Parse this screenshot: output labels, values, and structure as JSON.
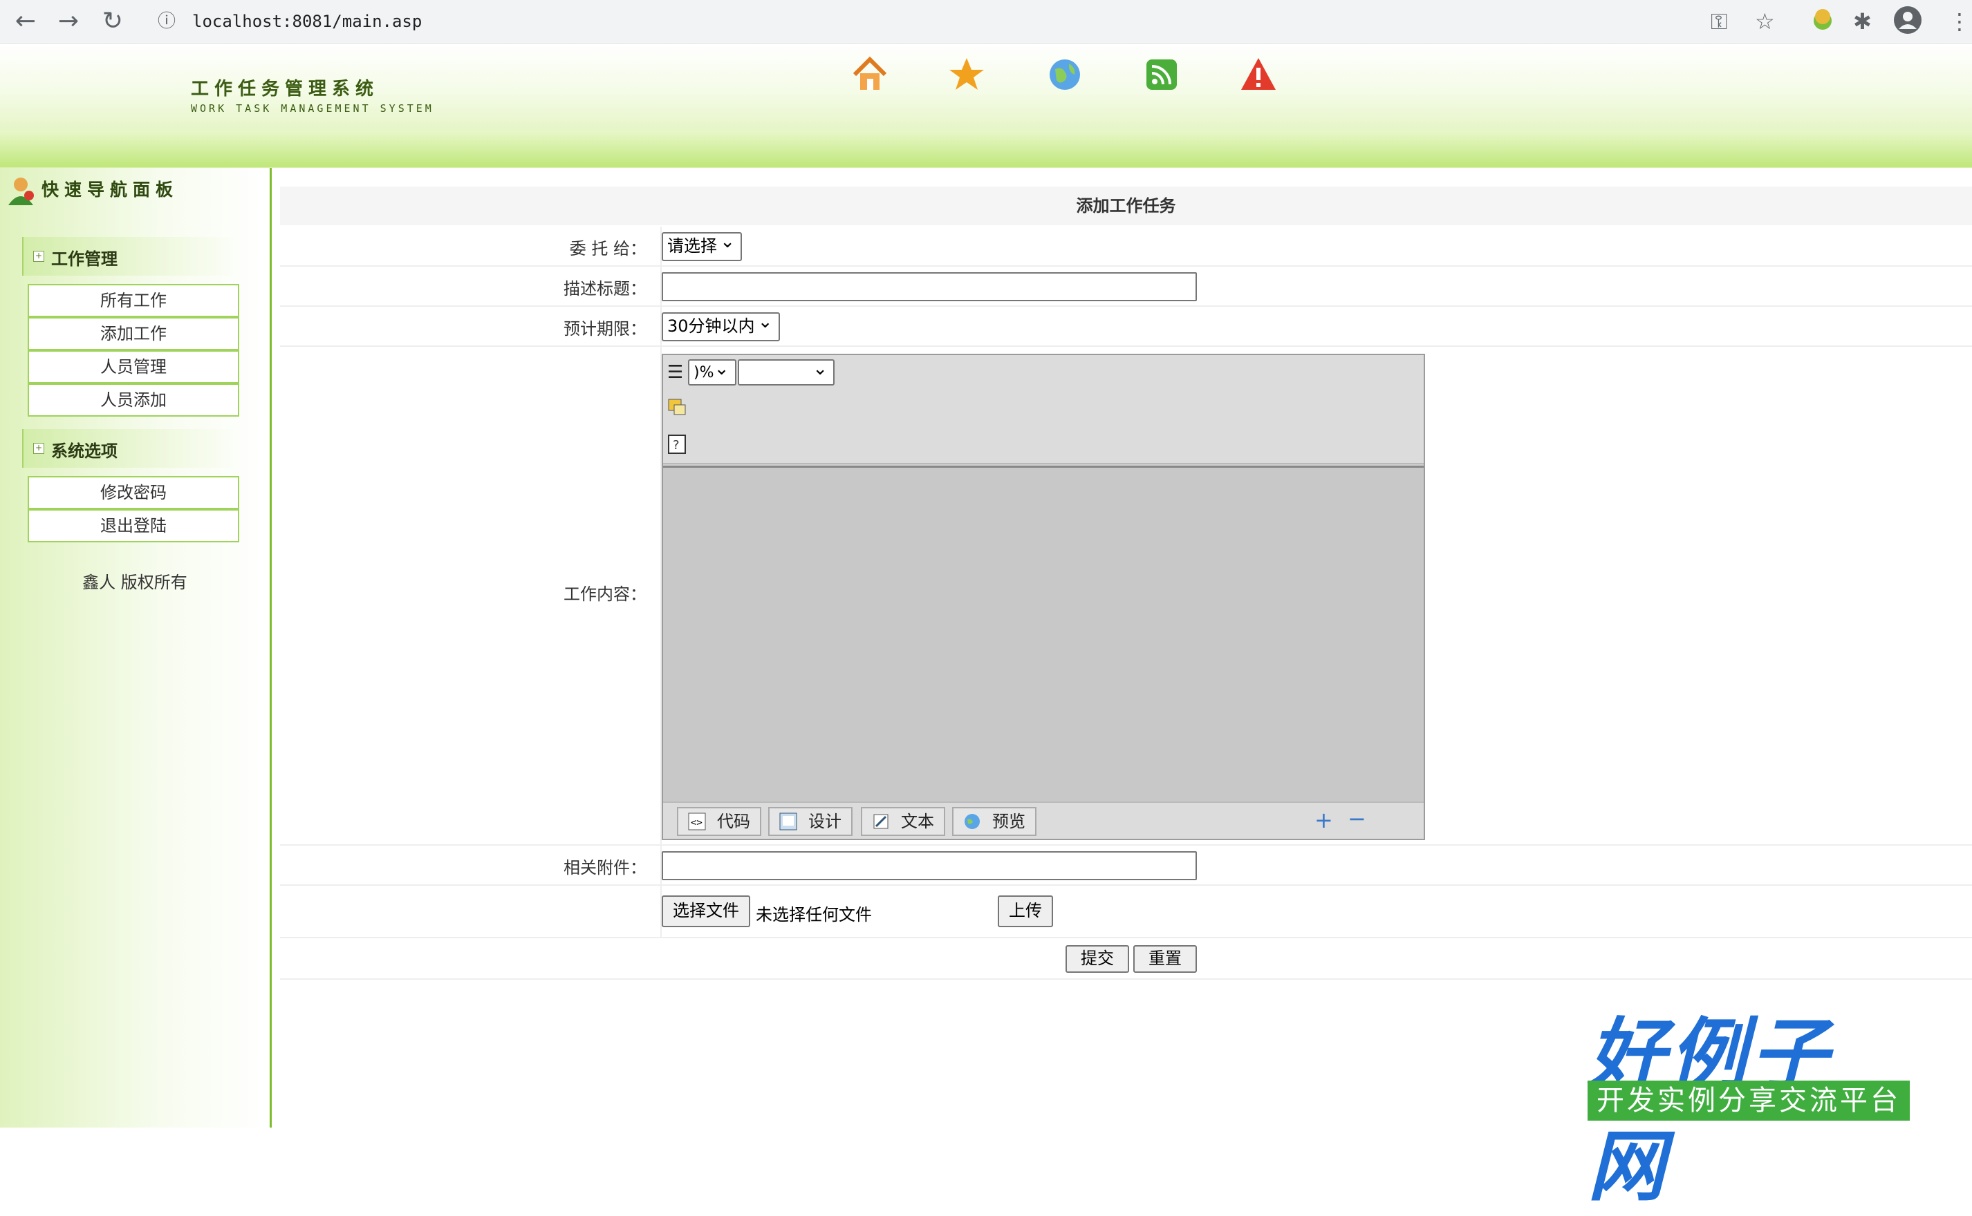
{
  "browser": {
    "url": "localhost:8081/main.asp"
  },
  "header": {
    "logo_cn": "工作任务管理系统",
    "logo_en": "WORK TASK MANAGEMENT SYSTEM",
    "icons": [
      "home-icon",
      "star-icon",
      "globe-icon",
      "rss-icon",
      "warning-icon"
    ]
  },
  "sidebar": {
    "title": "快速导航面板",
    "groups": [
      {
        "label": "工作管理",
        "items": [
          "所有工作",
          "添加工作",
          "人员管理",
          "人员添加"
        ]
      },
      {
        "label": "系统选项",
        "items": [
          "修改密码",
          "退出登陆"
        ]
      }
    ],
    "copyright": "鑫人 版权所有"
  },
  "form": {
    "title": "添加工作任务",
    "assign_label": "委 托 给：",
    "assign_value": "请选择",
    "subject_label": "描述标题：",
    "deadline_label": "预计期限：",
    "deadline_value": "30分钟以内",
    "content_label": "工作内容：",
    "editor": {
      "zoom_value": ")%",
      "mode_tabs": [
        "代码",
        "设计",
        "文本",
        "预览"
      ]
    },
    "attach_label": "相关附件：",
    "choose_file": "选择文件",
    "no_file": "未选择任何文件",
    "upload": "上传",
    "submit": "提交",
    "reset": "重置"
  },
  "watermark": {
    "brand": "好例子网",
    "slogan": "开发实例分享交流平台"
  }
}
